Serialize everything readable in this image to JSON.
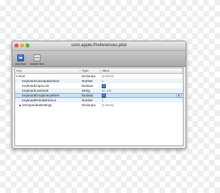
{
  "window": {
    "title": "com.apple.Preferences.plist"
  },
  "toolbar": {
    "add_label": "Add Item",
    "delete_label": "Delete Item"
  },
  "columns": {
    "key": "Key",
    "type": "Type",
    "value": "Value"
  },
  "rows": [
    {
      "key": "Root",
      "type": "Dictionary",
      "value": "(8 items)"
    },
    {
      "key": "KeyboardAutocapitalization",
      "type": "Number",
      "value": "1"
    },
    {
      "key": "KeyboardCapsLock",
      "type": "Boolean",
      "value": ""
    },
    {
      "key": "KeyboardLastUsed",
      "type": "String",
      "value": "en_US"
    },
    {
      "key": "KeyboardEmojiEverywhere",
      "type": "Boolean",
      "value": ""
    },
    {
      "key": "KeyboardPeriodShortcut",
      "type": "Number",
      "value": "1"
    },
    {
      "key": "UISuspendedSettings",
      "type": "Dictionary",
      "value": "(1 items)"
    }
  ],
  "colors": {
    "selection": "#cfe0f7",
    "close": "#e5524a",
    "minimize": "#e0b12c",
    "zoom": "#5fb344"
  }
}
